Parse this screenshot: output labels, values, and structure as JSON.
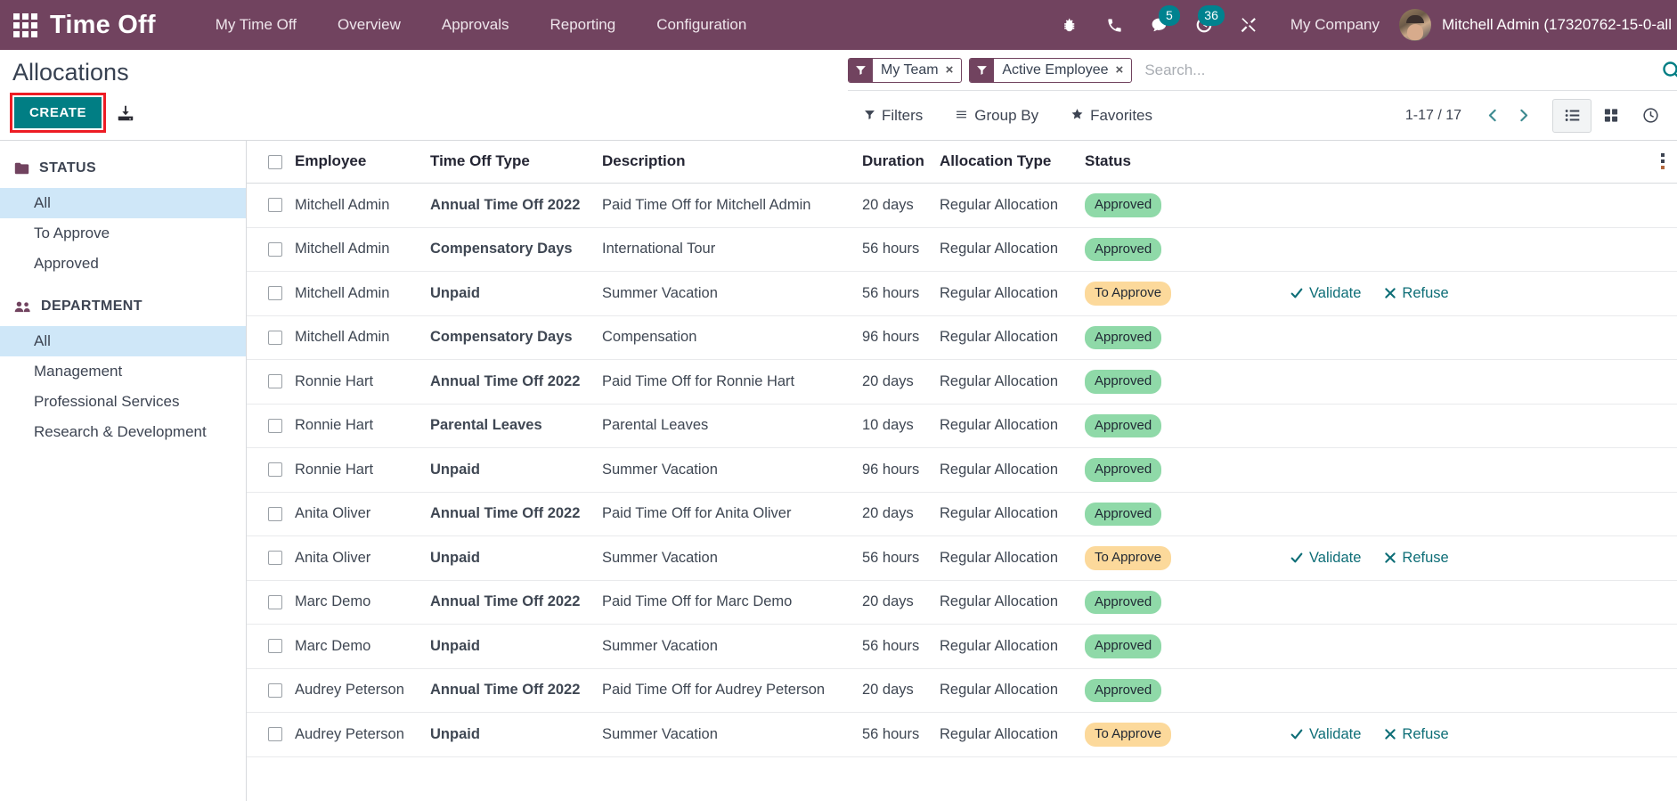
{
  "navbar": {
    "apps_icon": "apps-grid-icon",
    "brand": "Time Off",
    "menus": [
      {
        "label": "My Time Off"
      },
      {
        "label": "Overview"
      },
      {
        "label": "Approvals"
      },
      {
        "label": "Reporting"
      },
      {
        "label": "Configuration"
      }
    ],
    "sys_icons": [
      {
        "name": "bug-icon",
        "badge": null
      },
      {
        "name": "phone-icon",
        "badge": null
      },
      {
        "name": "messages-icon",
        "badge": "5"
      },
      {
        "name": "activities-clock-icon",
        "badge": "36"
      },
      {
        "name": "tools-icon",
        "badge": null
      }
    ],
    "company": "My Company",
    "user": "Mitchell Admin (17320762-15-0-all"
  },
  "control_panel": {
    "title": "Allocations",
    "create_label": "CREATE",
    "import_icon": "import-download-icon",
    "search": {
      "placeholder": "Search...",
      "facets": [
        {
          "icon": "filter-funnel-icon",
          "label": "My Team",
          "remove": "×"
        },
        {
          "icon": "filter-funnel-icon",
          "label": "Active Employee",
          "remove": "×"
        }
      ],
      "search_icon": "search-magnifier-icon"
    },
    "dropdowns": [
      {
        "icon": "funnel-icon",
        "label": "Filters"
      },
      {
        "icon": "bars-icon",
        "label": "Group By"
      },
      {
        "icon": "star-icon",
        "label": "Favorites"
      }
    ],
    "pager": "1-17 / 17",
    "prev_icon": "chevron-left-icon",
    "next_icon": "chevron-right-icon",
    "views": [
      {
        "name": "list-view-icon",
        "active": true
      },
      {
        "name": "kanban-view-icon",
        "active": false
      },
      {
        "name": "activity-view-icon",
        "active": false
      }
    ]
  },
  "sidebar": {
    "groups": [
      {
        "icon": "folder-icon",
        "title": "STATUS",
        "items": [
          {
            "label": "All",
            "active": true
          },
          {
            "label": "To Approve",
            "active": false
          },
          {
            "label": "Approved",
            "active": false
          }
        ]
      },
      {
        "icon": "people-icon",
        "title": "DEPARTMENT",
        "items": [
          {
            "label": "All",
            "active": true
          },
          {
            "label": "Management",
            "active": false
          },
          {
            "label": "Professional Services",
            "active": false
          },
          {
            "label": "Research & Development",
            "active": false
          }
        ]
      }
    ]
  },
  "table": {
    "columns": [
      "Employee",
      "Time Off Type",
      "Description",
      "Duration",
      "Allocation Type",
      "Status"
    ],
    "actions": {
      "validate": "Validate",
      "refuse": "Refuse"
    },
    "optional_columns_icon": "vertical-dots-icon",
    "rows": [
      {
        "employee": "Mitchell Admin",
        "type": "Annual Time Off 2022",
        "description": "Paid Time Off for Mitchell Admin",
        "duration": "20 days",
        "allocation_type": "Regular Allocation",
        "status": "Approved",
        "status_class": "approved",
        "has_actions": false
      },
      {
        "employee": "Mitchell Admin",
        "type": "Compensatory Days",
        "description": "International Tour",
        "duration": "56 hours",
        "allocation_type": "Regular Allocation",
        "status": "Approved",
        "status_class": "approved",
        "has_actions": false
      },
      {
        "employee": "Mitchell Admin",
        "type": "Unpaid",
        "description": "Summer Vacation",
        "duration": "56 hours",
        "allocation_type": "Regular Allocation",
        "status": "To Approve",
        "status_class": "to-approve",
        "has_actions": true
      },
      {
        "employee": "Mitchell Admin",
        "type": "Compensatory Days",
        "description": "Compensation",
        "duration": "96 hours",
        "allocation_type": "Regular Allocation",
        "status": "Approved",
        "status_class": "approved",
        "has_actions": false
      },
      {
        "employee": "Ronnie Hart",
        "type": "Annual Time Off 2022",
        "description": "Paid Time Off for Ronnie Hart",
        "duration": "20 days",
        "allocation_type": "Regular Allocation",
        "status": "Approved",
        "status_class": "approved",
        "has_actions": false
      },
      {
        "employee": "Ronnie Hart",
        "type": "Parental Leaves",
        "description": "Parental Leaves",
        "duration": "10 days",
        "allocation_type": "Regular Allocation",
        "status": "Approved",
        "status_class": "approved",
        "has_actions": false
      },
      {
        "employee": "Ronnie Hart",
        "type": "Unpaid",
        "description": "Summer Vacation",
        "duration": "96 hours",
        "allocation_type": "Regular Allocation",
        "status": "Approved",
        "status_class": "approved",
        "has_actions": false
      },
      {
        "employee": "Anita Oliver",
        "type": "Annual Time Off 2022",
        "description": "Paid Time Off for Anita Oliver",
        "duration": "20 days",
        "allocation_type": "Regular Allocation",
        "status": "Approved",
        "status_class": "approved",
        "has_actions": false
      },
      {
        "employee": "Anita Oliver",
        "type": "Unpaid",
        "description": "Summer Vacation",
        "duration": "56 hours",
        "allocation_type": "Regular Allocation",
        "status": "To Approve",
        "status_class": "to-approve",
        "has_actions": true
      },
      {
        "employee": "Marc Demo",
        "type": "Annual Time Off 2022",
        "description": "Paid Time Off for Marc Demo",
        "duration": "20 days",
        "allocation_type": "Regular Allocation",
        "status": "Approved",
        "status_class": "approved",
        "has_actions": false
      },
      {
        "employee": "Marc Demo",
        "type": "Unpaid",
        "description": "Summer Vacation",
        "duration": "56 hours",
        "allocation_type": "Regular Allocation",
        "status": "Approved",
        "status_class": "approved",
        "has_actions": false
      },
      {
        "employee": "Audrey Peterson",
        "type": "Annual Time Off 2022",
        "description": "Paid Time Off for Audrey Peterson",
        "duration": "20 days",
        "allocation_type": "Regular Allocation",
        "status": "Approved",
        "status_class": "approved",
        "has_actions": false
      },
      {
        "employee": "Audrey Peterson",
        "type": "Unpaid",
        "description": "Summer Vacation",
        "duration": "56 hours",
        "allocation_type": "Regular Allocation",
        "status": "To Approve",
        "status_class": "to-approve",
        "has_actions": true
      }
    ]
  },
  "colors": {
    "navbar_bg": "#71435f",
    "accent_teal": "#017e84",
    "highlight_red": "#ed1c24",
    "badge_approved": "#8fd9a8",
    "badge_to_approve": "#fcd99b",
    "sidebar_active": "#cfe7f8"
  }
}
